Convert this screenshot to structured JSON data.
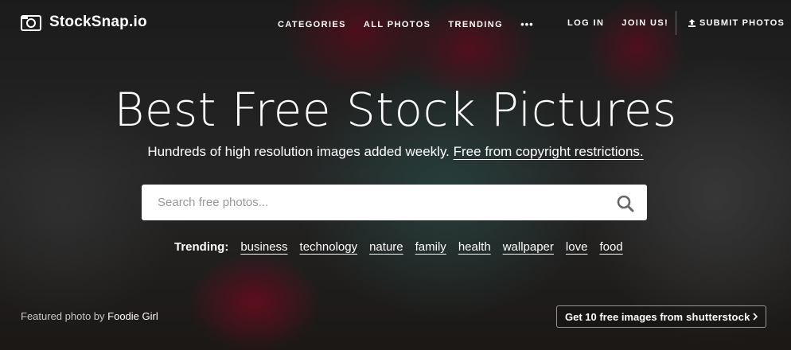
{
  "brand": {
    "name": "StockSnap.io",
    "icon": "camera-icon"
  },
  "nav": {
    "items": [
      "CATEGORIES",
      "ALL PHOTOS",
      "TRENDING"
    ],
    "more": "•••",
    "login": "LOG IN",
    "join": "JOIN US!",
    "submit": "SUBMIT PHOTOS",
    "submit_icon": "upload-icon"
  },
  "hero": {
    "title": "Best Free Stock Pictures",
    "subtitle": "Hundreds of high resolution images added weekly.",
    "subtitle_link": "Free from copyright restrictions."
  },
  "search": {
    "placeholder": "Search free photos...",
    "icon": "search-icon"
  },
  "trending": {
    "label": "Trending:",
    "tags": [
      "business",
      "technology",
      "nature",
      "family",
      "health",
      "wallpaper",
      "love",
      "food"
    ]
  },
  "footer": {
    "featured_prefix": "Featured photo by",
    "featured_author": "Foodie Girl",
    "shutter_text": "Get 10 free images from",
    "shutter_brand": "shutterstock",
    "shutter_icon": "chevron-right-icon"
  }
}
